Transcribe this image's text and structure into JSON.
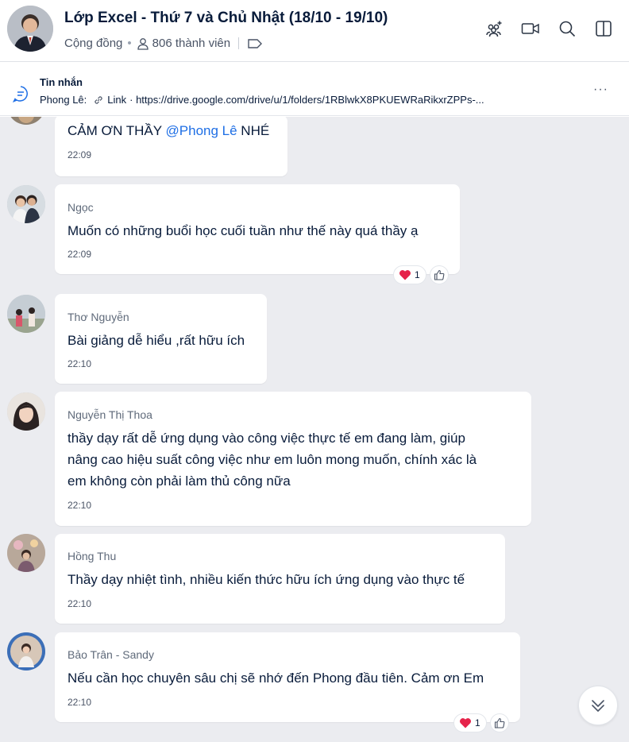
{
  "header": {
    "title": "Lớp Excel - Thứ 7 và Chủ Nhật (18/10 - 19/10)",
    "type_label": "Cộng đồng",
    "members": "806 thành viên",
    "icons": [
      "add-member-icon",
      "video-call-icon",
      "search-icon",
      "sidebar-toggle-icon"
    ]
  },
  "pinned": {
    "title": "Tin nhắn",
    "sender": "Phong Lê:",
    "link_label": "Link",
    "link_text": "· https://drive.google.com/drive/u/1/folders/1RBlwkX8PKUEWRaRikxrZPPs-...",
    "more": "···"
  },
  "messages": [
    {
      "sender": "",
      "text_before": "CẢM ƠN THẦY ",
      "mention": "@Phong Lê",
      "text_after": " NHÉ",
      "time": "22:09"
    },
    {
      "sender": "Ngọc",
      "lines": [
        "Muốn có những buổi học cuối tuần như thế này quá thầy ạ"
      ],
      "time": "22:09",
      "reaction_count": "1"
    },
    {
      "sender": "Thơ Nguyễn",
      "lines": [
        "Bài giảng dễ hiểu ,rất hữu ích"
      ],
      "time": "22:10"
    },
    {
      "sender": "Nguyễn Thị Thoa",
      "lines": [
        "thầy dạy rất dễ ứng dụng vào công việc thực tế em đang làm, giúp",
        "nâng cao hiệu suất công việc như em luôn mong muốn, chính xác là",
        "em không còn phải làm thủ công nữa"
      ],
      "time": "22:10"
    },
    {
      "sender": "Hồng Thu",
      "lines": [
        "Thầy dạy nhiệt tình, nhiều kiến thức hữu ích ứng dụng vào thực tế"
      ],
      "time": "22:10"
    },
    {
      "sender": "Bảo Trân - Sandy",
      "lines": [
        "Nếu cần học chuyên sâu chị sẽ nhớ đến Phong đầu tiên. Cảm ơn Em"
      ],
      "time": "22:10",
      "reaction_count": "1"
    }
  ],
  "colors": {
    "accent": "#1f6fe5",
    "heart": "#e5234a",
    "chat_bg": "#ebecf0"
  }
}
